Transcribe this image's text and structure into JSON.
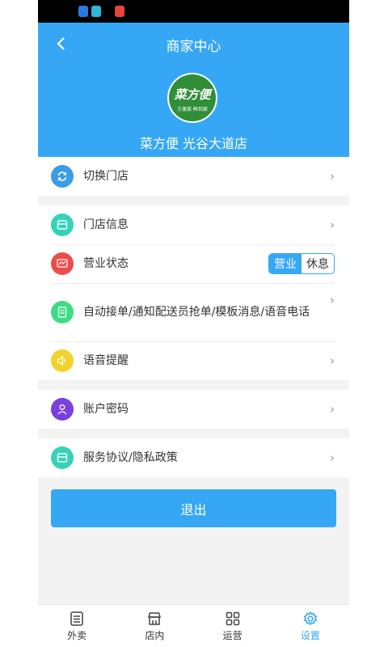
{
  "header": {
    "title": "商家中心",
    "logo_text": "菜方便",
    "logo_sub": "方便菜·鲜到家",
    "store_name": "菜方便 光谷大道店"
  },
  "menu": {
    "switch_store": "切换门店",
    "store_info": "门店信息",
    "business_status": "营业状态",
    "status_open": "营业",
    "status_closed": "休息",
    "auto_settings": "自动接单/通知配送员抢单/模板消息/语音电话",
    "voice_reminder": "语音提醒",
    "account_password": "账户密码",
    "agreement": "服务协议/隐私政策"
  },
  "logout_label": "退出",
  "tabs": [
    {
      "label": "外卖"
    },
    {
      "label": "店内"
    },
    {
      "label": "运营"
    },
    {
      "label": "设置"
    }
  ],
  "colors": {
    "accent": "#36a7f5",
    "switch_icon": "#3b9ce8",
    "store_icon": "#34d3b7",
    "status_icon": "#ee4b4b",
    "auto_icon": "#3ddc84",
    "voice_icon": "#f2d22e",
    "account_icon": "#7a3fe0",
    "agreement_icon": "#34d3b7"
  }
}
